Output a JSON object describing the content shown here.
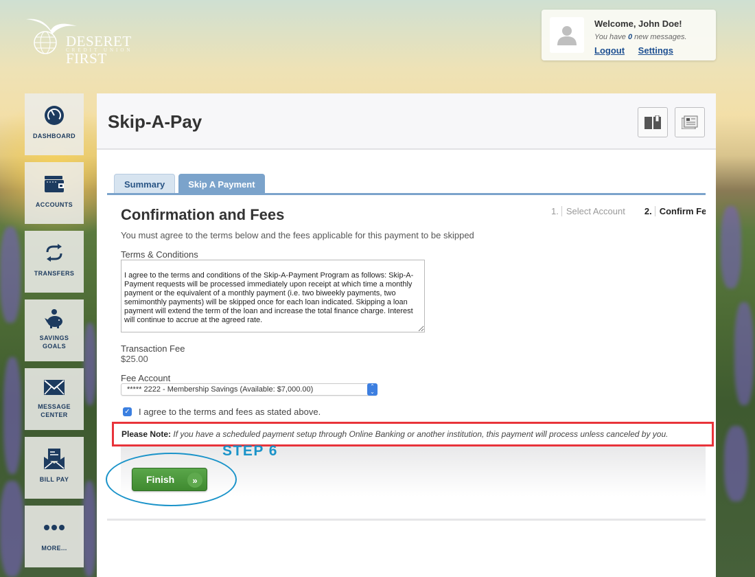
{
  "brand": {
    "name": "DESERET FIRST",
    "sub": "CREDIT UNION"
  },
  "welcome": {
    "greeting": "Welcome, John Doe!",
    "messages_prefix": "You have ",
    "messages_count": "0",
    "messages_suffix": " new messages.",
    "logout": "Logout",
    "settings": "Settings"
  },
  "sidebar": {
    "items": [
      {
        "label": "DASHBOARD",
        "icon": "dashboard-gauge-icon"
      },
      {
        "label": "ACCOUNTS",
        "icon": "wallet-icon"
      },
      {
        "label": "TRANSFERS",
        "icon": "transfer-arrows-icon"
      },
      {
        "label": "SAVINGS GOALS",
        "icon": "piggy-bank-icon"
      },
      {
        "label": "MESSAGE CENTER",
        "icon": "envelope-icon"
      },
      {
        "label": "BILL PAY",
        "icon": "bill-envelope-icon"
      },
      {
        "label": "MORE...",
        "icon": "more-dots-icon"
      }
    ]
  },
  "page": {
    "title": "Skip-A-Pay",
    "header_buttons": [
      {
        "icon": "book-icon"
      },
      {
        "icon": "newspaper-icon"
      }
    ]
  },
  "tabs": [
    {
      "label": "Summary",
      "active": false
    },
    {
      "label": "Skip A Payment",
      "active": true
    }
  ],
  "confirm": {
    "title": "Confirmation and Fees",
    "steps": [
      {
        "num": "1.",
        "label": "Select Account",
        "state": "done"
      },
      {
        "num": "2.",
        "label": "Confirm Fees",
        "state": "current"
      }
    ],
    "intro": "You must agree to the terms below and the fees applicable for this payment to be skipped",
    "terms_label": "Terms & Conditions",
    "terms_text": "I agree to the terms and conditions of the Skip-A-Payment Program as follows: Skip-A-Payment requests will be processed immediately upon receipt at which time a monthly payment or the equivalent of a monthly payment (i.e. two biweekly payments, two semimonthly payments) will be skipped once for each loan indicated.  Skipping a loan payment will extend the term of the loan and increase the total finance charge.  Interest will continue to accrue at the agreed rate.",
    "fee_label": "Transaction Fee",
    "fee_value": "$25.00",
    "fee_account_label": "Fee Account",
    "fee_account_selected": "***** 2222 - Membership Savings (Available: $7,000.00)",
    "agree_label": "I agree to the terms and fees as stated above.",
    "agree_checked": true,
    "note_label": "Please Note:",
    "note_text": "If you have a scheduled payment setup through Online Banking or another institution, this payment will process unless canceled by you."
  },
  "annotation": {
    "step_label": "STEP 6",
    "highlight_color": "#e8333a",
    "circle_color": "#1a93c9"
  },
  "actions": {
    "finish": "Finish",
    "finish_icon": "»"
  }
}
